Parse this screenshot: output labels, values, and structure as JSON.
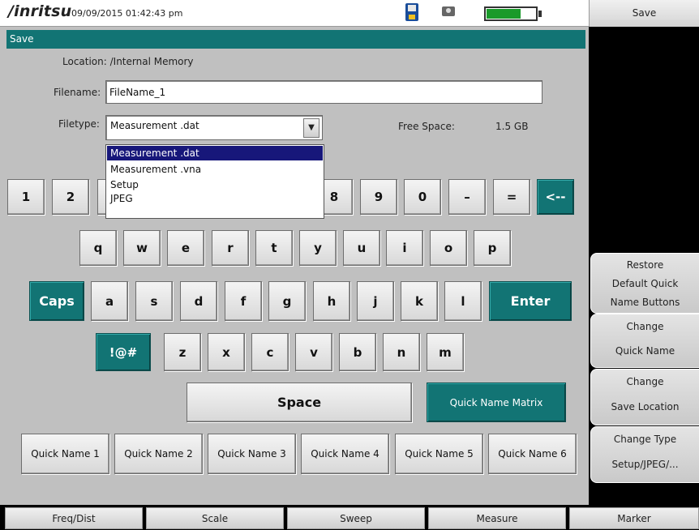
{
  "status": {
    "brand": "/inritsu",
    "datetime": "09/09/2015 01:42:43 pm",
    "battery_level_percent": 70
  },
  "dialog": {
    "title": "Save",
    "location_label": "Location: /Internal Memory",
    "filename_label": "Filename:",
    "filename_value": "FileName_1",
    "filetype_label": "Filetype:",
    "filetype_value": "Measurement .dat",
    "free_space_label": "Free Space:",
    "free_space_value": "1.5 GB",
    "filetype_options": [
      "Measurement .dat",
      "Measurement .vna",
      "Setup",
      "JPEG"
    ],
    "selected_option": "Measurement .dat"
  },
  "keyboard": {
    "row1": [
      "1",
      "2",
      "8",
      "9",
      "0",
      "–",
      "=",
      "<--"
    ],
    "row2": [
      "q",
      "w",
      "e",
      "r",
      "t",
      "y",
      "u",
      "i",
      "o",
      "p"
    ],
    "row3": [
      "Caps",
      "a",
      "s",
      "d",
      "f",
      "g",
      "h",
      "j",
      "k",
      "l",
      "Enter"
    ],
    "row4": [
      "!@#",
      "z",
      "x",
      "c",
      "v",
      "b",
      "n",
      "m"
    ],
    "space": "Space",
    "quick_name_matrix": "Quick Name Matrix",
    "quick_names": [
      "Quick Name 1",
      "Quick Name 2",
      "Quick Name 3",
      "Quick Name 4",
      "Quick Name 5",
      "Quick Name 6"
    ]
  },
  "softkeys": {
    "title": "Save",
    "restore": [
      "Restore",
      "Default Quick",
      "Name Buttons"
    ],
    "change_quick_name": [
      "Change",
      "Quick Name"
    ],
    "change_save_location": [
      "Change",
      "Save Location"
    ],
    "change_type": [
      "Change Type",
      "Setup/JPEG/..."
    ]
  },
  "tabs": [
    "Freq/Dist",
    "Scale",
    "Sweep",
    "Measure",
    "Marker"
  ],
  "colors": {
    "teal": "#127474",
    "selection": "#17177a",
    "panel": "#c0c0c0"
  }
}
